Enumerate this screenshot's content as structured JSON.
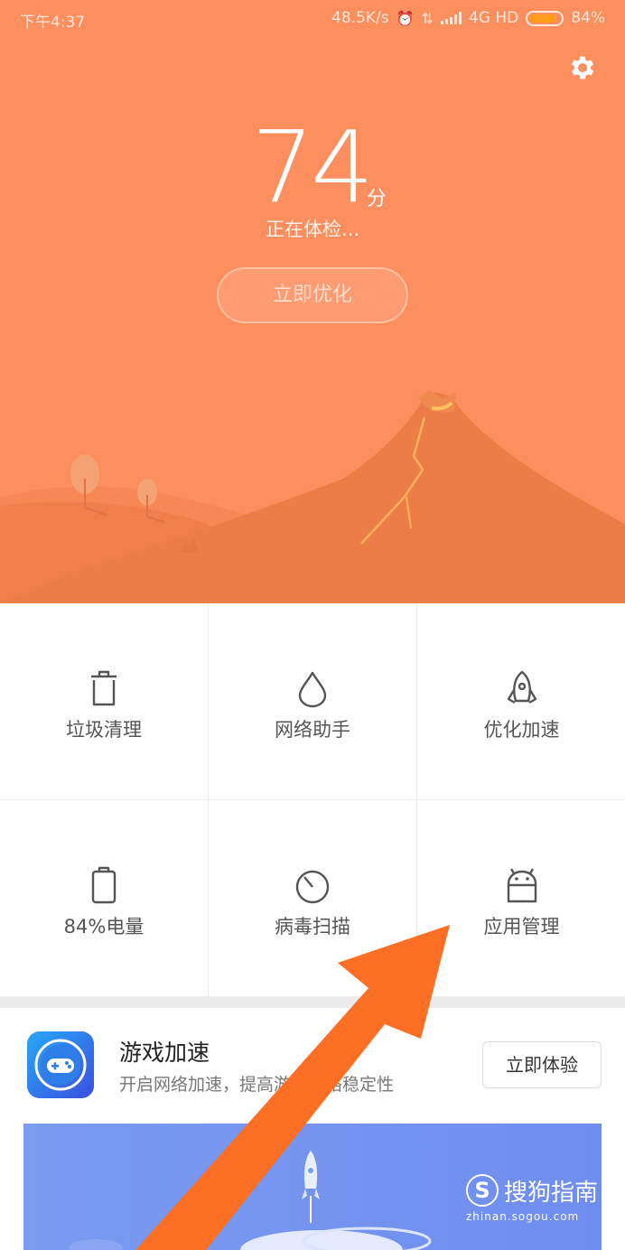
{
  "status_bar": {
    "time": "下午4:37",
    "speed": "48.5K/s",
    "network": "4G HD",
    "battery": "84%",
    "battery_level": 0.84
  },
  "header": {
    "score": "74",
    "score_unit": "分",
    "status": "正在体检...",
    "optimize_label": "立即优化"
  },
  "tools": [
    {
      "label": "垃圾清理",
      "icon": "trash-icon"
    },
    {
      "label": "网络助手",
      "icon": "droplet-icon"
    },
    {
      "label": "优化加速",
      "icon": "rocket-icon"
    },
    {
      "label": "84%电量",
      "icon": "battery-icon"
    },
    {
      "label": "病毒扫描",
      "icon": "scan-icon"
    },
    {
      "label": "应用管理",
      "icon": "android-icon"
    }
  ],
  "promo": {
    "title": "游戏加速",
    "description": "开启网络加速，提高游戏网络稳定性",
    "button_label": "立即体验",
    "icon": "gamepad-icon"
  },
  "watermark": {
    "logo": "S",
    "text": "搜狗指南",
    "url": "zhinan.sogou.com"
  },
  "colors": {
    "hero_bg": "#fd8e5e",
    "accent_arrow": "#fd6f24",
    "banner_bg": "#7a9bf0"
  }
}
